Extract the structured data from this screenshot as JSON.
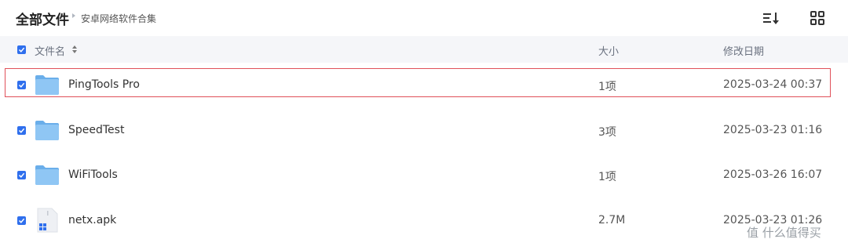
{
  "breadcrumb": {
    "root": "全部文件",
    "current": "安卓网络软件合集"
  },
  "table": {
    "col_name": "文件名",
    "col_size": "大小",
    "col_date": "修改日期"
  },
  "rows": [
    {
      "name": "PingTools Pro",
      "size": "1项",
      "date": "2025-03-24 00:37",
      "type": "folder",
      "highlighted": true
    },
    {
      "name": "SpeedTest",
      "size": "3项",
      "date": "2025-03-23 01:16",
      "type": "folder"
    },
    {
      "name": "WiFiTools",
      "size": "1项",
      "date": "2025-03-26 16:07",
      "type": "folder"
    },
    {
      "name": "netx.apk",
      "size": "2.7M",
      "date": "2025-03-23 01:26",
      "type": "apk-file"
    }
  ],
  "watermark": "值 什么值得买",
  "colors": {
    "accent": "#2f6fed",
    "folder": "#7cb8f0",
    "highlight": "#e0505a"
  }
}
